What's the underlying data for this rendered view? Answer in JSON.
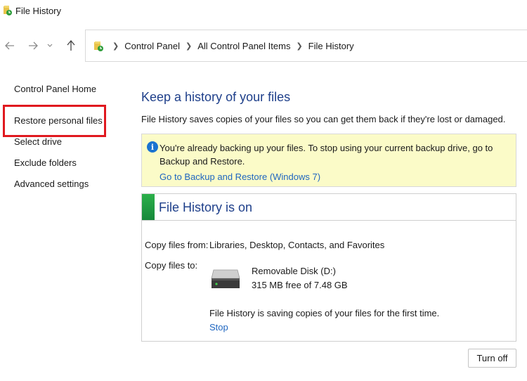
{
  "window": {
    "title": "File History"
  },
  "nav": {
    "back_icon": "arrow-left-icon",
    "forward_icon": "arrow-right-icon",
    "recent_icon": "chevron-down-icon",
    "up_icon": "arrow-up-icon"
  },
  "address": {
    "crumbs": [
      "Control Panel",
      "All Control Panel Items",
      "File History"
    ]
  },
  "sidebar": {
    "items": [
      {
        "label": "Control Panel Home"
      },
      {
        "label": "Restore personal files"
      },
      {
        "label": "Select drive"
      },
      {
        "label": "Exclude folders"
      },
      {
        "label": "Advanced settings"
      }
    ],
    "highlight_color": "#e0191f"
  },
  "main": {
    "heading": "Keep a history of your files",
    "description": "File History saves copies of your files so you can get them back if they're lost or damaged.",
    "info": {
      "text": "You're already backing up your files. To stop using your current backup drive, go to Backup and Restore.",
      "link": "Go to Backup and Restore (Windows 7)"
    },
    "status": {
      "title": "File History is on",
      "copy_from_label": "Copy files from:",
      "copy_from_value": "Libraries, Desktop, Contacts, and Favorites",
      "copy_to_label": "Copy files to:",
      "drive_name": "Removable Disk (D:)",
      "drive_space": "315 MB free of 7.48 GB",
      "progress_text": "File History is saving copies of your files for the first time.",
      "stop_link": "Stop"
    },
    "turn_off_label": "Turn off"
  },
  "colors": {
    "heading": "#1e3f8a",
    "link": "#1f66c0",
    "info_bg": "#fbfbc8",
    "status_green": "#2bb04a"
  }
}
